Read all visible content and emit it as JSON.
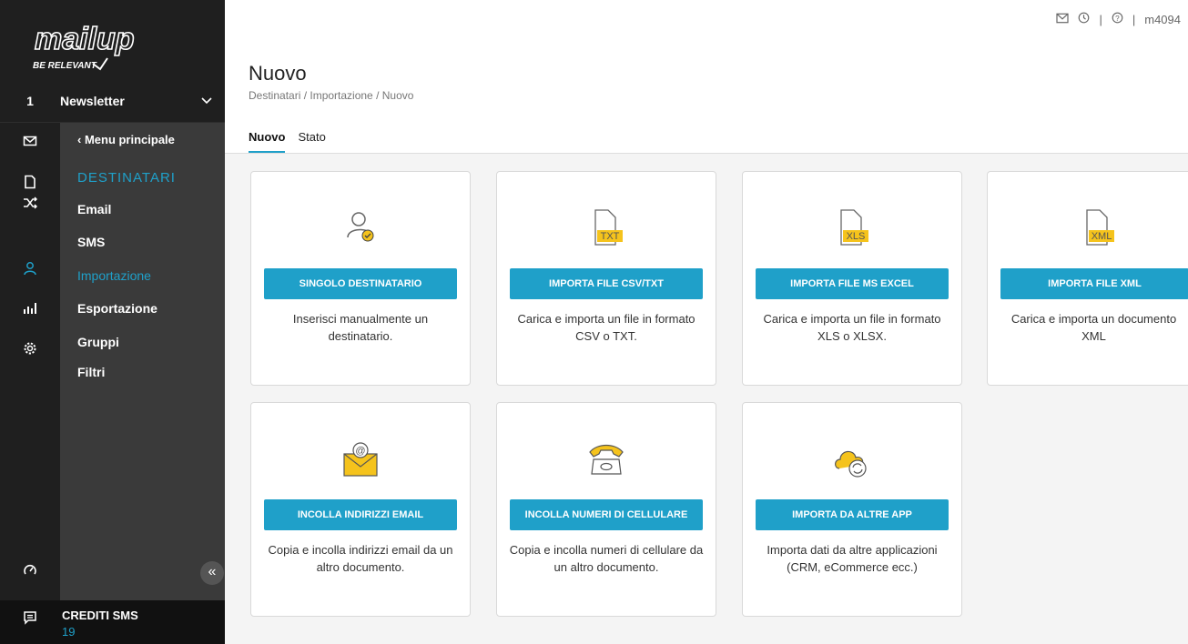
{
  "brand": {
    "logo": "mailup",
    "tagline": "BE RELEVANT"
  },
  "account": {
    "number": "1",
    "name": "Newsletter"
  },
  "menu": {
    "back": "‹  Menu principale",
    "section": "DESTINATARI",
    "items": [
      {
        "label": "Email"
      },
      {
        "label": "SMS"
      },
      {
        "label": "Importazione"
      },
      {
        "label": "Esportazione"
      },
      {
        "label": "Gruppi"
      },
      {
        "label": "Filtri"
      }
    ]
  },
  "footer": {
    "label": "CREDITI SMS",
    "value": "19"
  },
  "topbar": {
    "sep1": "|",
    "sep2": "|",
    "user": "m4094"
  },
  "header": {
    "title": "Nuovo",
    "breadcrumb": "Destinatari / Importazione / Nuovo"
  },
  "tabs": [
    {
      "label": "Nuovo"
    },
    {
      "label": "Stato"
    }
  ],
  "cards": [
    {
      "button": "SINGOLO DESTINATARIO",
      "desc": "Inserisci manualmente un destinatario.",
      "icon": "user-check-icon"
    },
    {
      "button": "IMPORTA FILE CSV/TXT",
      "desc": "Carica e importa un file in formato CSV o TXT.",
      "icon": "txt-file-icon",
      "badge": "TXT"
    },
    {
      "button": "IMPORTA FILE MS EXCEL",
      "desc": "Carica e importa un file in formato XLS o XLSX.",
      "icon": "xls-file-icon",
      "badge": "XLS"
    },
    {
      "button": "IMPORTA FILE XML",
      "desc": "Carica e importa un documento XML",
      "icon": "xml-file-icon",
      "badge": "XML"
    },
    {
      "button": "INCOLLA INDIRIZZI EMAIL",
      "desc": "Copia e incolla indirizzi email da un altro documento.",
      "icon": "email-at-icon"
    },
    {
      "button": "INCOLLA NUMERI DI CELLULARE",
      "desc": "Copia e incolla numeri di cellulare da un altro documento.",
      "icon": "phone-icon"
    },
    {
      "button": "IMPORTA DA ALTRE APP",
      "desc": "Importa dati da altre applicazioni (CRM, eCommerce ecc.)",
      "icon": "cloud-sync-icon"
    }
  ],
  "colors": {
    "accent": "#1fa0c9",
    "sidebar": "#1f1f1f",
    "panel": "#3a3a3a",
    "icon_yellow": "#f5c31c"
  }
}
